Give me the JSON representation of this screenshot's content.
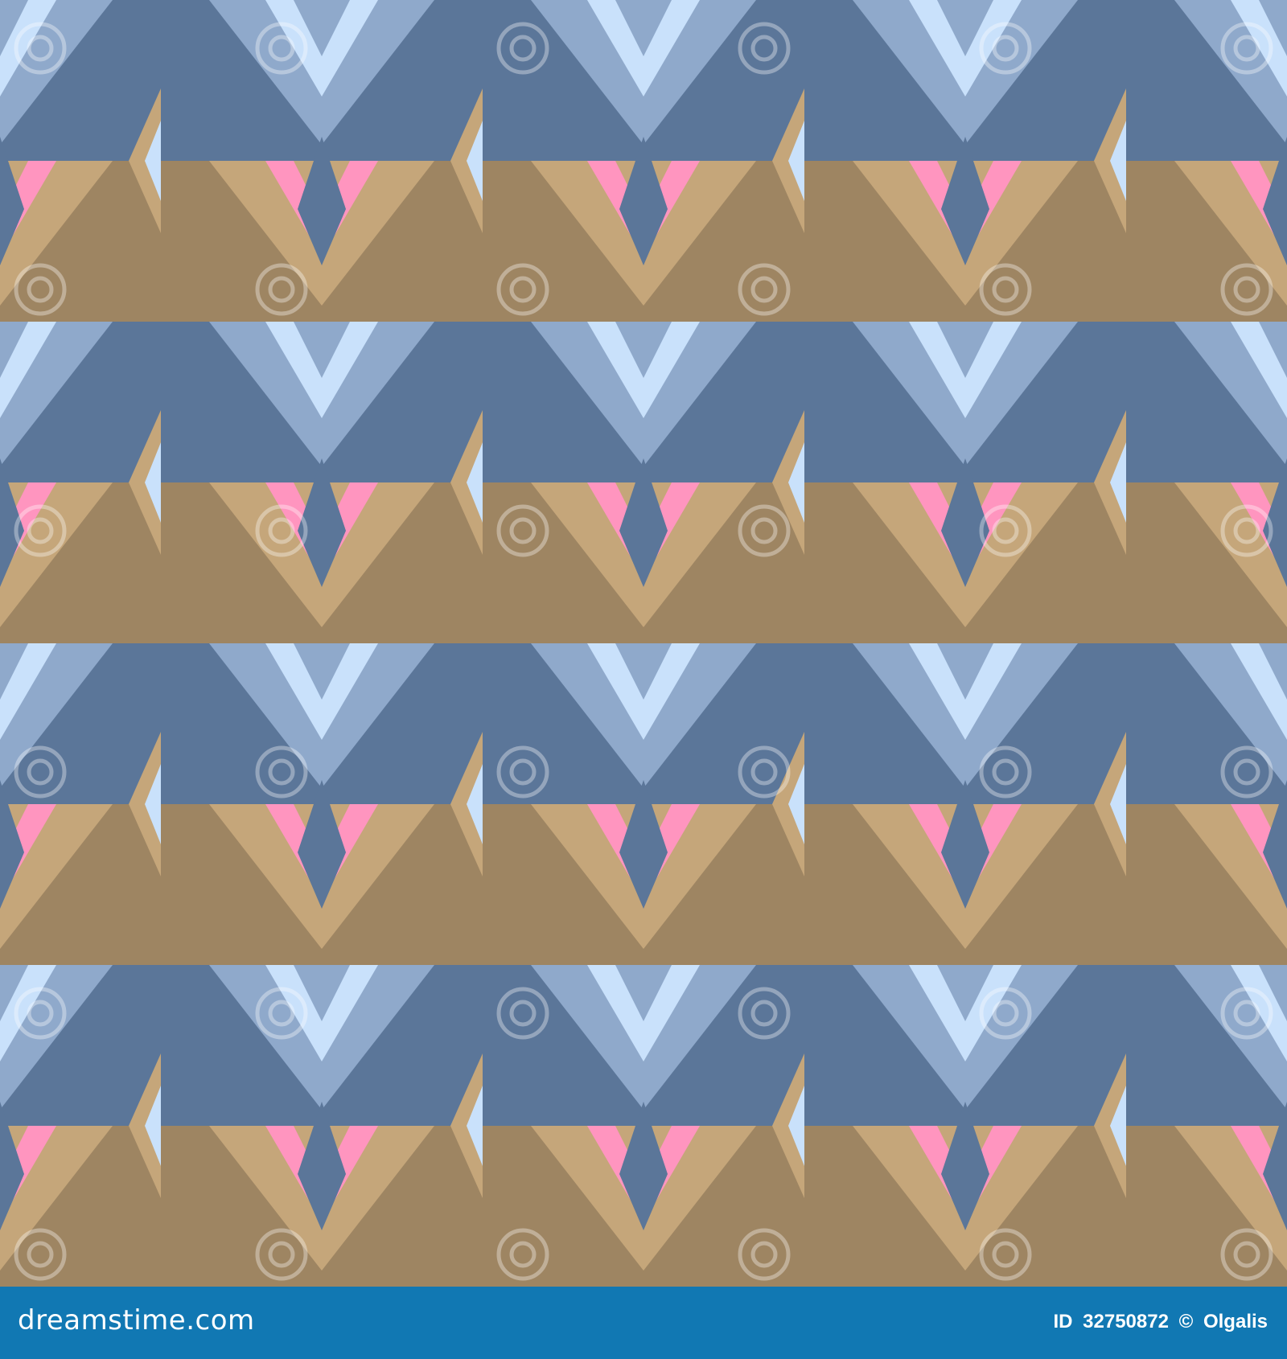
{
  "image": {
    "description_type": "seamless geometric pattern stock image",
    "palette": {
      "slate_blue": "#5b7699",
      "periwinkle": "#8fa9cb",
      "ice_blue": "#c9e1fb",
      "tan": "#c5a67a",
      "khaki": "#9e8562",
      "pink": "#ff95bf"
    },
    "watermark": {
      "text": "dreamstime",
      "icon": "spiral-icon"
    }
  },
  "footer": {
    "logo_text": "dreamstime.com",
    "id_label": "ID",
    "id_number": "32750872",
    "author_separator": "©",
    "author": "Olgalis",
    "bar_color": "#1178b3"
  }
}
